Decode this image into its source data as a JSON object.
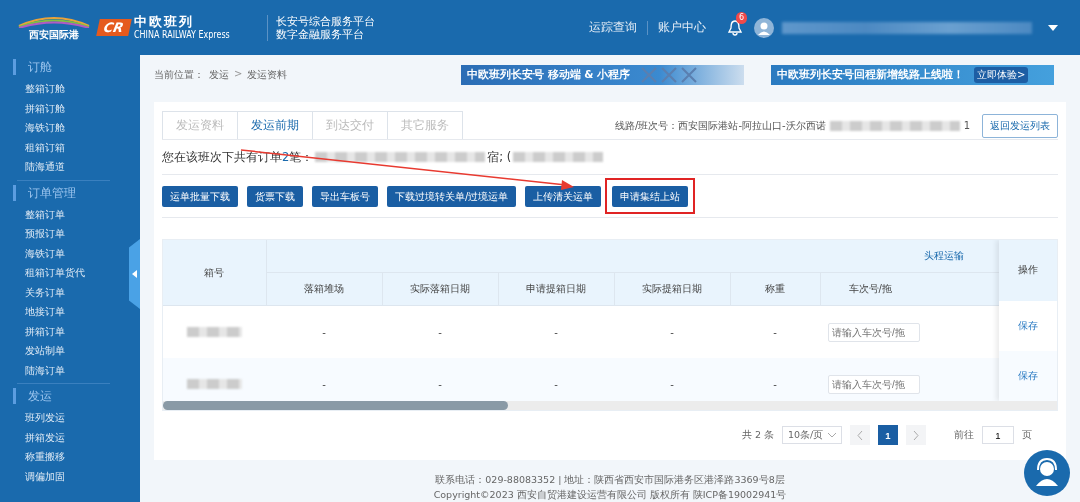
{
  "header": {
    "logo_text": "西安国际港",
    "cr_logo": "CR",
    "cr_title": "中欧班列",
    "cr_subtitle": "CHINA RAILWAY Express",
    "platform_lines": [
      "长安号综合服务平台",
      "数字金融服务平台"
    ],
    "nav": [
      "运踪查询",
      "账户中心"
    ],
    "notification_count": "6"
  },
  "sidebar": {
    "sections": [
      {
        "title": "订舱",
        "items": [
          "整箱订舱",
          "拼箱订舱",
          "海铁订舱",
          "租箱订箱",
          "陆海通道"
        ]
      },
      {
        "title": "订单管理",
        "items": [
          "整箱订单",
          "预报订单",
          "海铁订单",
          "租箱订单货代",
          "关务订单",
          "地接订单",
          "拼箱订单",
          "发站制单",
          "陆海订单"
        ]
      },
      {
        "title": "发运",
        "items": [
          "班列发运",
          "拼箱发运",
          "称重搬移",
          "调偏加固"
        ]
      }
    ]
  },
  "breadcrumb": {
    "label": "当前位置：",
    "separator": ">",
    "items": [
      "发运",
      "发运资料"
    ]
  },
  "banners": [
    {
      "text": "中欧班列长安号 移动端 & 小程序"
    },
    {
      "text": "中欧班列长安号回程新增线路上线啦！",
      "cta": "立即体验>"
    }
  ],
  "tabs": [
    {
      "label": "发运资料",
      "selected": false
    },
    {
      "label": "发运前期",
      "selected": true
    },
    {
      "label": "到达交付",
      "selected": false
    },
    {
      "label": "其它服务",
      "selected": false
    }
  ],
  "route": {
    "label": "线路/班次号：",
    "value": "西安国际港站-阿拉山口-沃尔西诺",
    "tail": "1"
  },
  "back_button": "返回发运列表",
  "summary": {
    "prefix": "您在该班次下共有订单",
    "count": "2",
    "suffix": "笔：",
    "mid": "宿; ("
  },
  "actions": [
    {
      "label": "运单批量下载",
      "highlighted": false
    },
    {
      "label": "货票下载",
      "highlighted": false
    },
    {
      "label": "导出车板号",
      "highlighted": false
    },
    {
      "label": "下载过境转关单/过境运单",
      "highlighted": false
    },
    {
      "label": "上传清关运单",
      "highlighted": false
    },
    {
      "label": "申请集结上站",
      "highlighted": true
    }
  ],
  "table": {
    "first_column": "箱号",
    "group": "头程运输",
    "columns": [
      "落箱堆场",
      "实际落箱日期",
      "申请提箱日期",
      "实际提箱日期",
      "称重",
      "车次号/拖"
    ],
    "action_column": "操作",
    "rows": [
      {
        "cells": [
          "-",
          "-",
          "-",
          "-",
          "-"
        ],
        "placeholder": "请输入车次号/拖",
        "action": "保存"
      },
      {
        "cells": [
          "-",
          "-",
          "-",
          "-",
          "-"
        ],
        "placeholder": "请输入车次号/拖",
        "action": "保存"
      }
    ]
  },
  "pagination": {
    "total": "共 2 条",
    "page_size": "10条/页",
    "pages": [
      {
        "label": "1",
        "selected": true
      }
    ],
    "goto_label": "前往",
    "goto_value": "1",
    "page_unit": "页"
  },
  "footer": [
    "联系电话：029-88083352 | 地址：陕西省西安市国际港务区港泽路3369号8层",
    "Copyright©2023 西安自贸港建设运营有限公司 版权所有 陕ICP备19002941号"
  ]
}
